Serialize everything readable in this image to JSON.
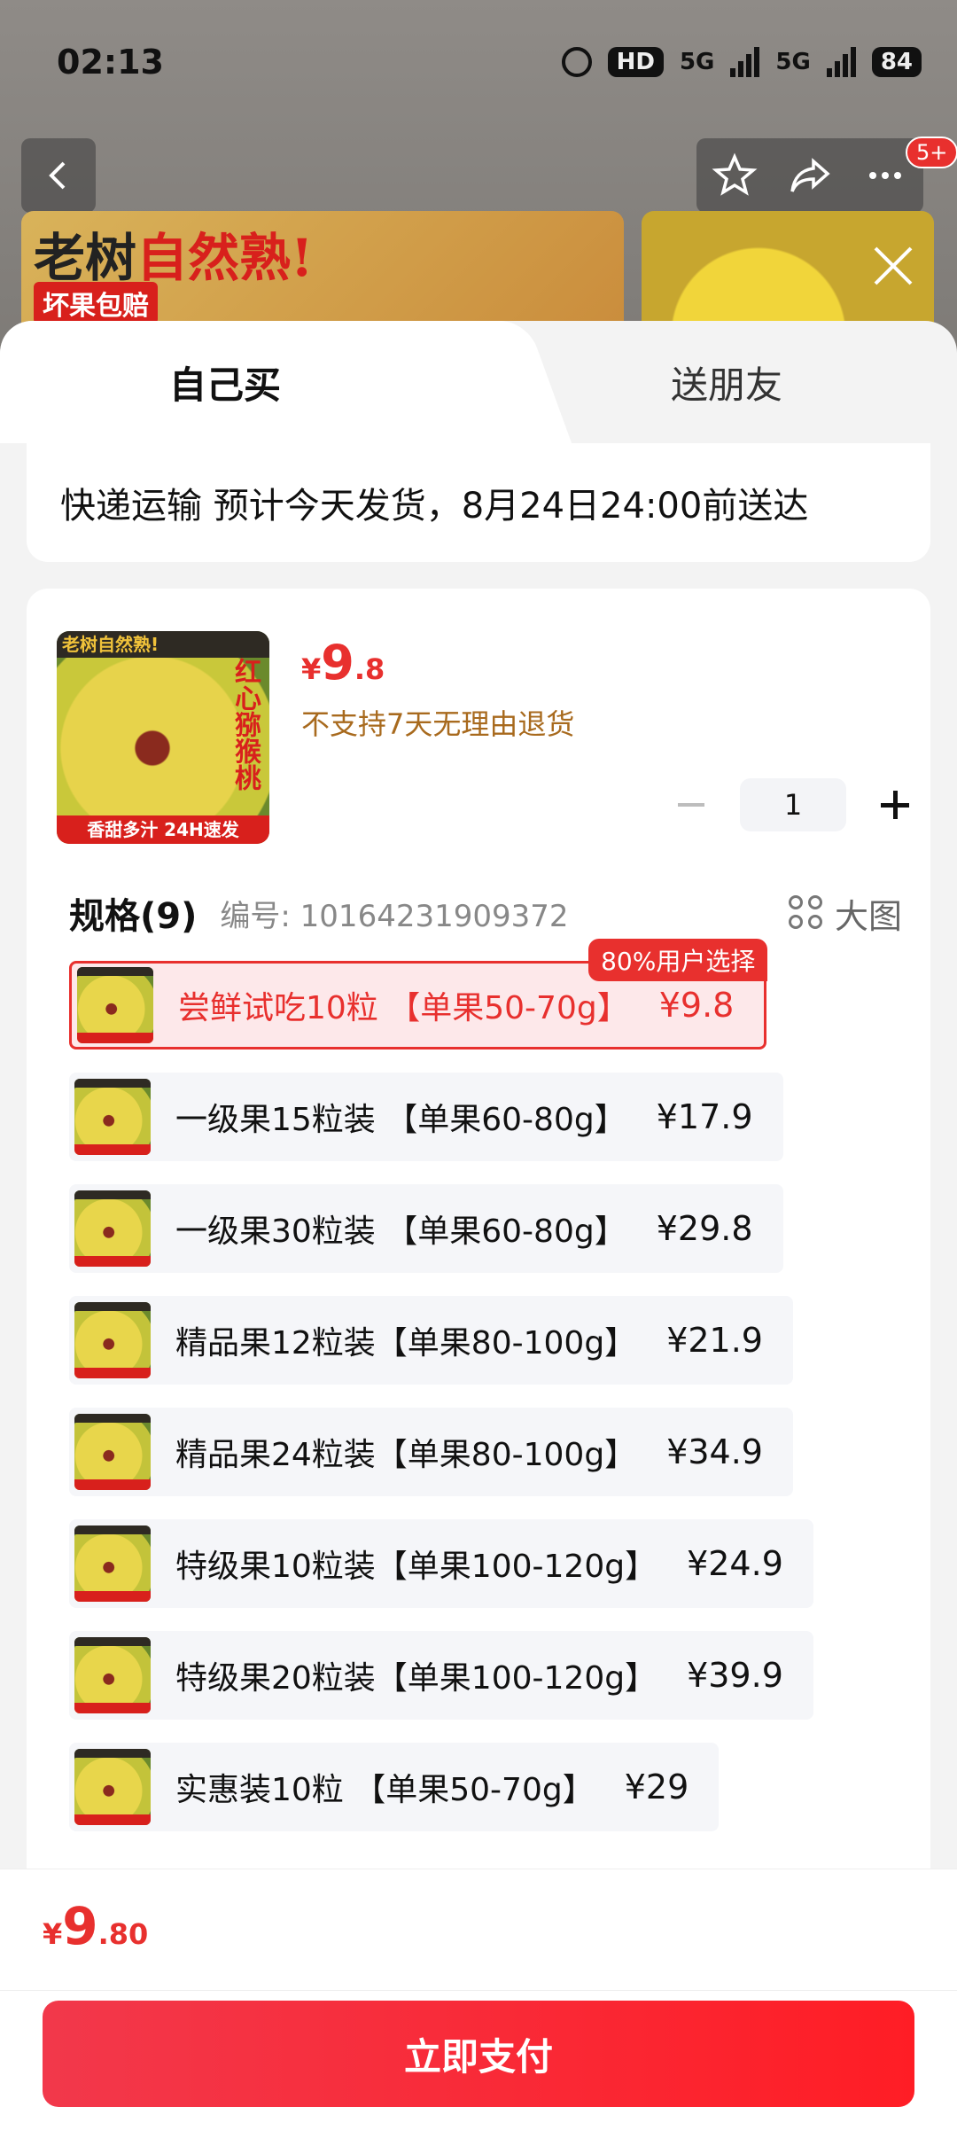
{
  "status_bar": {
    "time": "02:13",
    "hd": "HD",
    "net1": "5G",
    "net2": "5G",
    "battery": "84"
  },
  "nav": {
    "badge": "5+"
  },
  "banner": {
    "title_part1": "老树",
    "title_part2": "自然熟!",
    "subtitle": "坏果包赔"
  },
  "tabs": {
    "self": "自己买",
    "friend": "送朋友"
  },
  "delivery": {
    "text": "快递运输 预计今天发货，8月24日24:00前送达"
  },
  "product": {
    "thumb_top": "老树自然熟!",
    "thumb_side": "红心猕猴桃",
    "thumb_bottom": "香甜多汁 24H速发",
    "price_currency": "¥",
    "price_int": "9",
    "price_dec": ".8",
    "no_return": "不支持7天无理由退货",
    "quantity": "1"
  },
  "spec": {
    "title": "规格(9)",
    "code": "编号: 10164231909372",
    "big_pic": "大图",
    "items": [
      {
        "name": "尝鲜试吃10粒 【单果50-70g】",
        "price": "¥9.8",
        "tag": "80%用户选择"
      },
      {
        "name": "一级果15粒装 【单果60-80g】",
        "price": "¥17.9"
      },
      {
        "name": "一级果30粒装 【单果60-80g】",
        "price": "¥29.8"
      },
      {
        "name": "精品果12粒装【单果80-100g】",
        "price": "¥21.9"
      },
      {
        "name": "精品果24粒装【单果80-100g】",
        "price": "¥34.9"
      },
      {
        "name": "特级果10粒装【单果100-120g】",
        "price": "¥24.9"
      },
      {
        "name": "特级果20粒装【单果100-120g】",
        "price": "¥39.9"
      },
      {
        "name": "实惠装10粒 【单果50-70g】",
        "price": "¥29"
      }
    ]
  },
  "bottom": {
    "currency": "¥",
    "total_int": "9",
    "total_dec": ".80",
    "pay_label": "立即支付"
  },
  "colors": {
    "accent": "#e8302e",
    "return_note": "#a86a1e"
  }
}
